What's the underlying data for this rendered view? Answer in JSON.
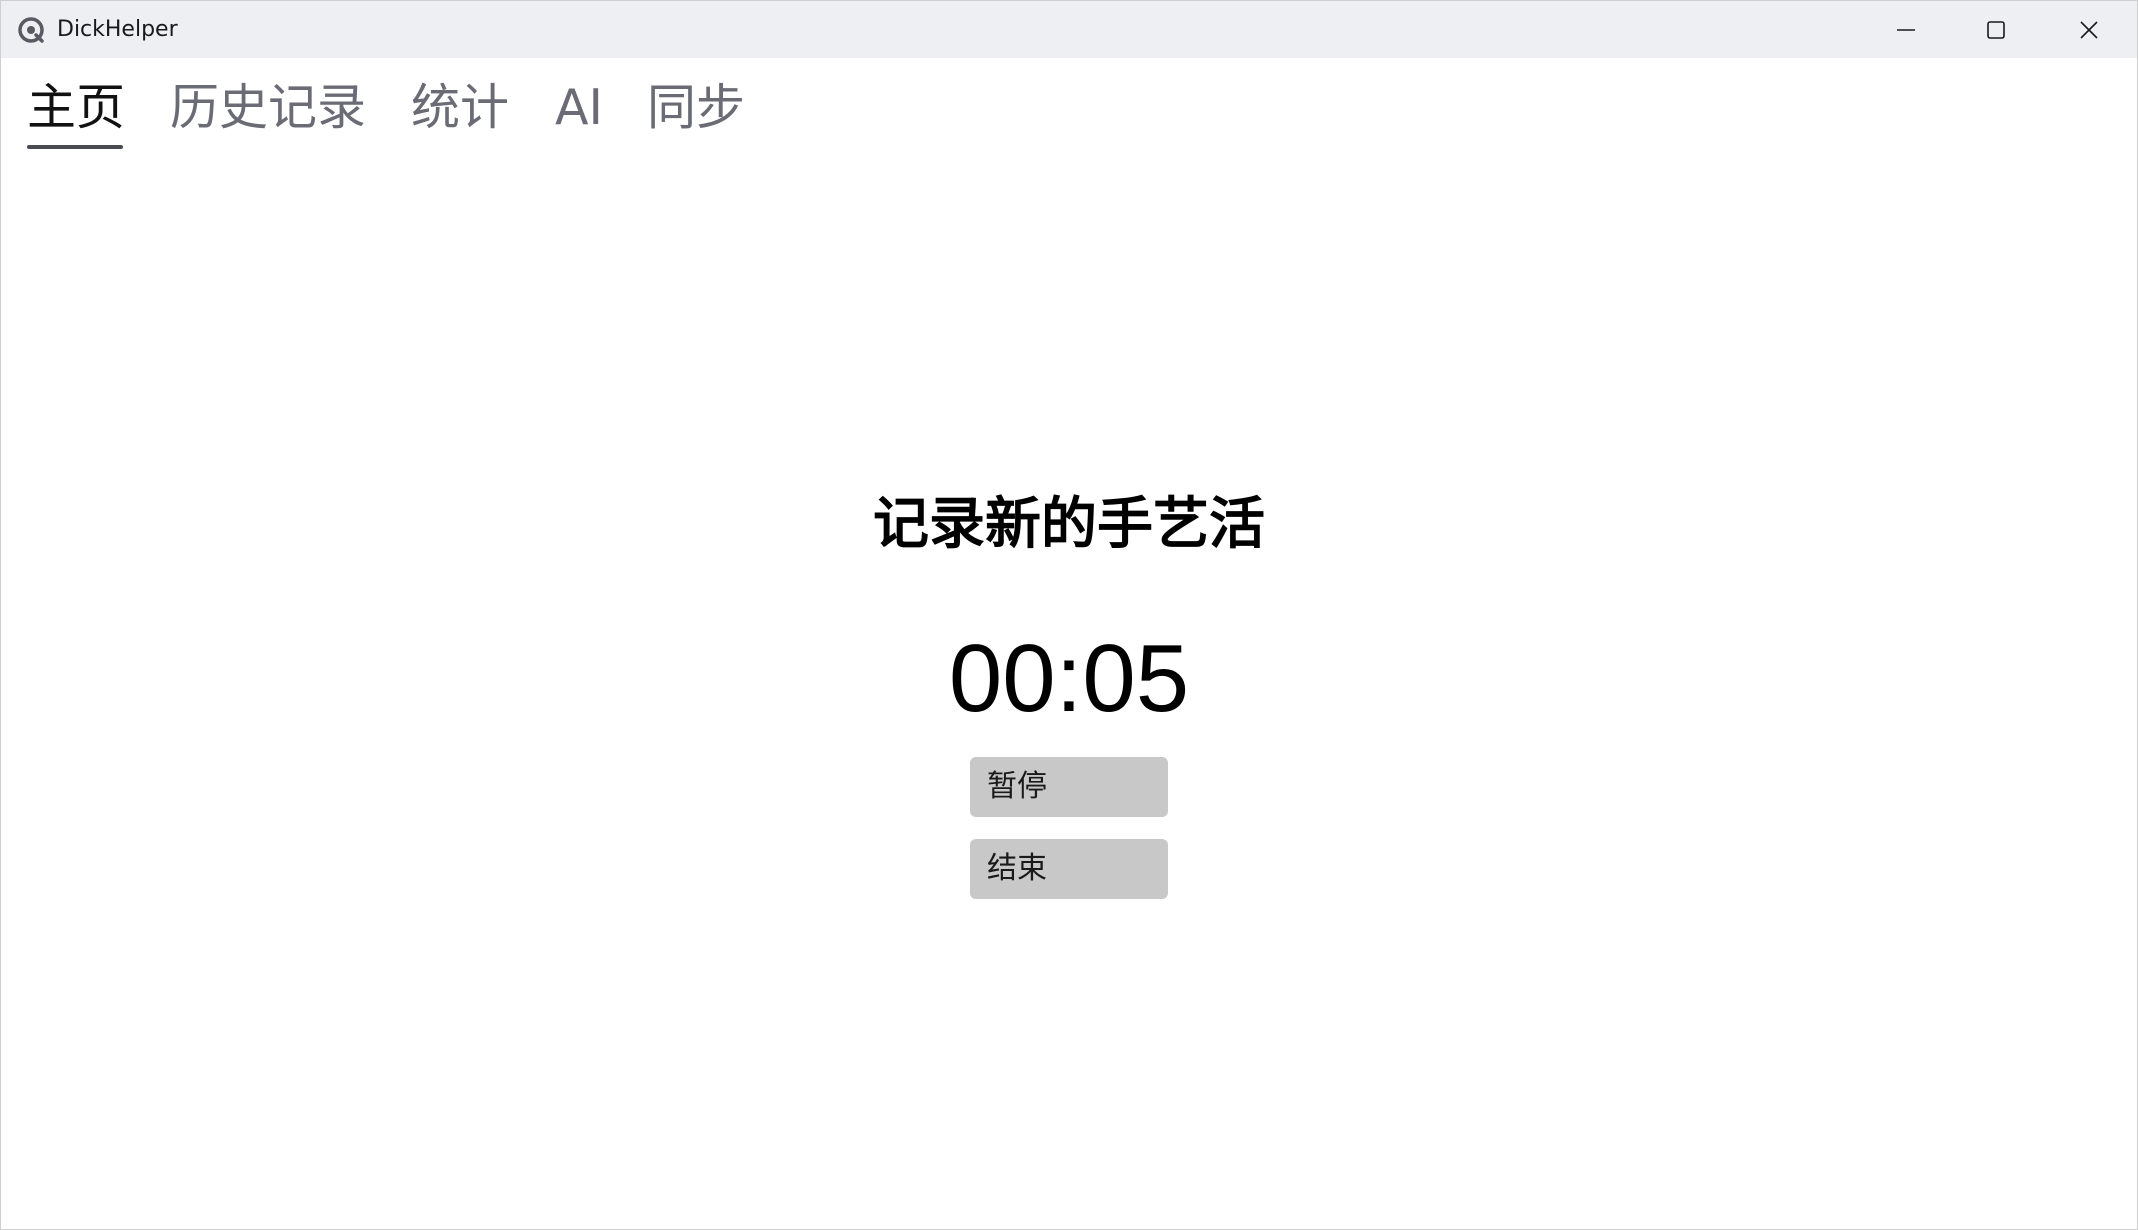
{
  "window": {
    "title": "DickHelper",
    "minimize_icon": "minimize-icon",
    "maximize_icon": "maximize-icon",
    "close_icon": "close-icon"
  },
  "tabs": [
    {
      "label": "主页",
      "active": true
    },
    {
      "label": "历史记录",
      "active": false
    },
    {
      "label": "统计",
      "active": false
    },
    {
      "label": "AI",
      "active": false
    },
    {
      "label": "同步",
      "active": false
    }
  ],
  "main": {
    "heading": "记录新的手艺活",
    "timer": "00:05",
    "pause_label": "暂停",
    "end_label": "结束"
  },
  "colors": {
    "titlebar_bg": "#eeeff3",
    "tab_active": "#111111",
    "tab_inactive": "#6b6b76",
    "button_bg": "#c8c8c8"
  }
}
